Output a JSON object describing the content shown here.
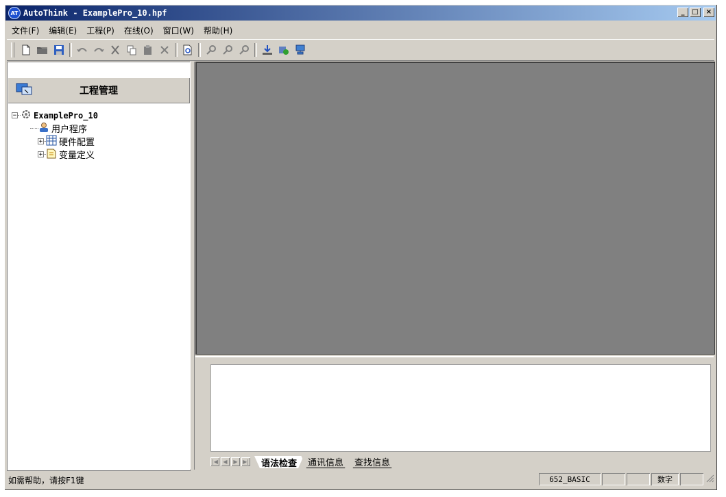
{
  "window": {
    "title": "AutoThink - ExamplePro_10.hpf",
    "logo_text": "AT",
    "minimize": "_",
    "maximize": "□",
    "close": "×"
  },
  "menu": [
    {
      "label": "文件(F)"
    },
    {
      "label": "编辑(E)"
    },
    {
      "label": "工程(P)"
    },
    {
      "label": "在线(O)"
    },
    {
      "label": "窗口(W)"
    },
    {
      "label": "帮助(H)"
    }
  ],
  "toolbar": {
    "icons": [
      "new-file-icon",
      "open-folder-icon",
      "save-icon",
      "undo-icon",
      "redo-icon",
      "cut-icon",
      "copy-icon",
      "paste-icon",
      "delete-icon",
      "print-preview-icon",
      "find-icon",
      "find-next-icon",
      "replace-icon",
      "download-icon",
      "compile-icon",
      "network-icon"
    ]
  },
  "project_panel": {
    "title": "工程管理",
    "root": "ExamplePro_10",
    "nodes": [
      {
        "label": "用户程序",
        "expander": ""
      },
      {
        "label": "硬件配置",
        "expander": "+"
      },
      {
        "label": "变量定义",
        "expander": "+"
      }
    ],
    "root_expander": "−"
  },
  "output": {
    "nav": [
      "|◀",
      "◀",
      "▶",
      "▶|"
    ],
    "tabs": [
      {
        "label": "语法检查",
        "active": true
      },
      {
        "label": "通讯信息",
        "active": false
      },
      {
        "label": "查找信息",
        "active": false
      }
    ]
  },
  "status": {
    "help_text": "如需帮助，请按F1键",
    "version": "652_BASIC",
    "cell2": "",
    "cell3": "",
    "numlock": "数字",
    "cell5": ""
  },
  "colors": {
    "title_start": "#0a246a",
    "title_end": "#a6caf0",
    "face": "#d4d0c8",
    "editor_bg": "#808080"
  }
}
